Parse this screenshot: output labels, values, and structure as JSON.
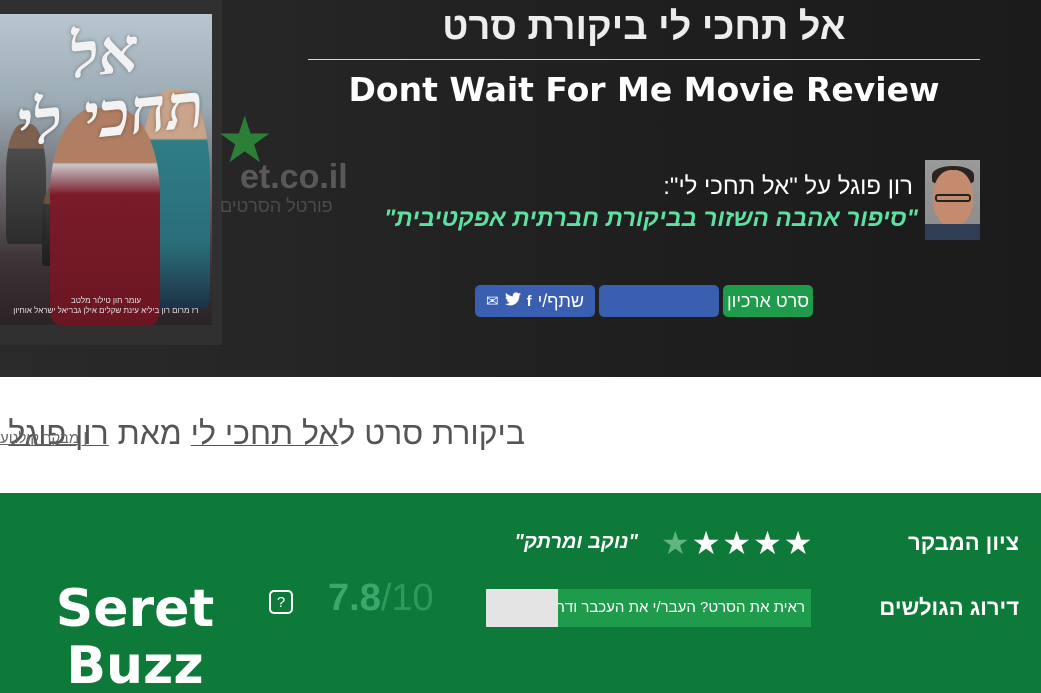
{
  "hero": {
    "title_hebrew": "אל תחכי לי ביקורת סרט",
    "title_english": "Dont Wait For Me Movie Review",
    "poster": {
      "title": "אל תחכי לי",
      "credits_line1": "עומר חון   טילור מלטב",
      "credits_line2": "רז מרום   רון ביליא   עינת שקלים   אילן גבריאל   ישראל אוחיון"
    },
    "watermark": {
      "text": "et.co.il",
      "sub": "פורטל הסרטים"
    },
    "critic_line": "רון פוגל על \"אל תחכי לי\":",
    "critic_quote": "\"סיפור אהבה השזור בביקורת חברתית אפקטיבית\"",
    "buttons": {
      "archive": "סרט ארכיון",
      "blue": "",
      "share": "שתף/י"
    }
  },
  "subheader": {
    "prefix": "ביקורת סרט ל",
    "movie_link": "אל תחכי לי",
    "middle": " מאת ",
    "critic_link": "רון פוגל",
    "small_sep": " | ",
    "small_link": "מבקר קולנוע"
  },
  "scores": {
    "critic_label": "ציון המבקר",
    "critic_stars": 4.5,
    "verdict": "\"נוקב ומרתק\"",
    "users_label": "דירוג הגולשים",
    "vote_prompt": "ראית את הסרט? העבר/י את העכבר ודרג/י!",
    "user_score": "7.8",
    "user_max": "10",
    "slash": "/",
    "help": "?",
    "brand_line1": "Seret",
    "brand_line2": "Buzz"
  },
  "colors": {
    "hero_bg": "#1f1f1f",
    "green_panel": "#0d7a3a",
    "button_green": "#1e9b4b",
    "button_blue": "#3a5fb0",
    "quote_color": "#5ee0a0"
  },
  "icons": {
    "facebook": "facebook-icon",
    "twitter": "twitter-icon",
    "email": "email-icon",
    "star": "star-icon"
  }
}
